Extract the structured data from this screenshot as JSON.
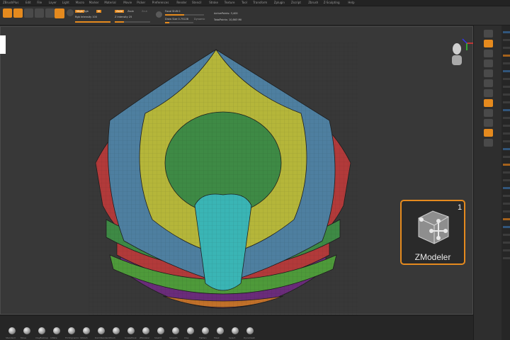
{
  "menu": {
    "items": [
      "ZBrushPlus",
      "Edit",
      "File",
      "Layer",
      "Light",
      "Macro",
      "Marker",
      "Material",
      "Movie",
      "Picker",
      "Preferences",
      "Render",
      "Stencil",
      "Stroke",
      "Texture",
      "Tool",
      "Transform",
      "Zplugin",
      "Zscript",
      "Zbrush",
      "Z-Sculpting",
      "Help"
    ]
  },
  "toolbar": {
    "mrgb_label": "Mrgb",
    "rgb_label": "Rgb",
    "m_label": "M",
    "zadd_label": "Zadd",
    "zsub_label": "Zsub",
    "zcut_label": "Zcut",
    "rgb_intensity_label": "Rgb Intensity 100",
    "z_intensity_label": "Z Intensity 25",
    "focal_shift_label": "Focal Shift 0",
    "draw_size_label": "Draw Size 0.75228",
    "dynamic_label": "Dynamic",
    "active_points_label": "ActivePoints: 3,400",
    "total_points_label": "TotalPoints: 10,863 Mil",
    "rgb_intensity": 1.0,
    "z_intensity": 0.25
  },
  "tray": {
    "buttons": [
      "Draw",
      "Persp",
      "Floor",
      "Local",
      "Frame",
      "Move",
      "Scale",
      "Rotate",
      "Line Fill",
      "Transp",
      "Solo",
      "Xpose"
    ]
  },
  "zmodeler": {
    "label": "ZModeler",
    "number": "1",
    "icon": "zmodeler-cube-icon"
  },
  "shelf": {
    "brushes": [
      "Standard",
      "Move",
      "ClayBuildup",
      "Inflate",
      "TrimDynamic",
      "hPolish",
      "DamStandard",
      "Pinch",
      "SnakeHook",
      "ZModeler",
      "Slash3",
      "Smooth",
      "Clay",
      "Flatten",
      "Mask",
      "Select",
      "Dynamesh"
    ]
  },
  "colors": {
    "accent": "#e58a1e",
    "viewport_bg": "#383838",
    "mesh_yellow": "#b5b63a",
    "mesh_blue": "#4e7fa0",
    "mesh_green": "#3e8a45",
    "mesh_red": "#b23a3a",
    "mesh_cyan": "#3ab5b5",
    "mesh_purple": "#6a2c7a"
  }
}
